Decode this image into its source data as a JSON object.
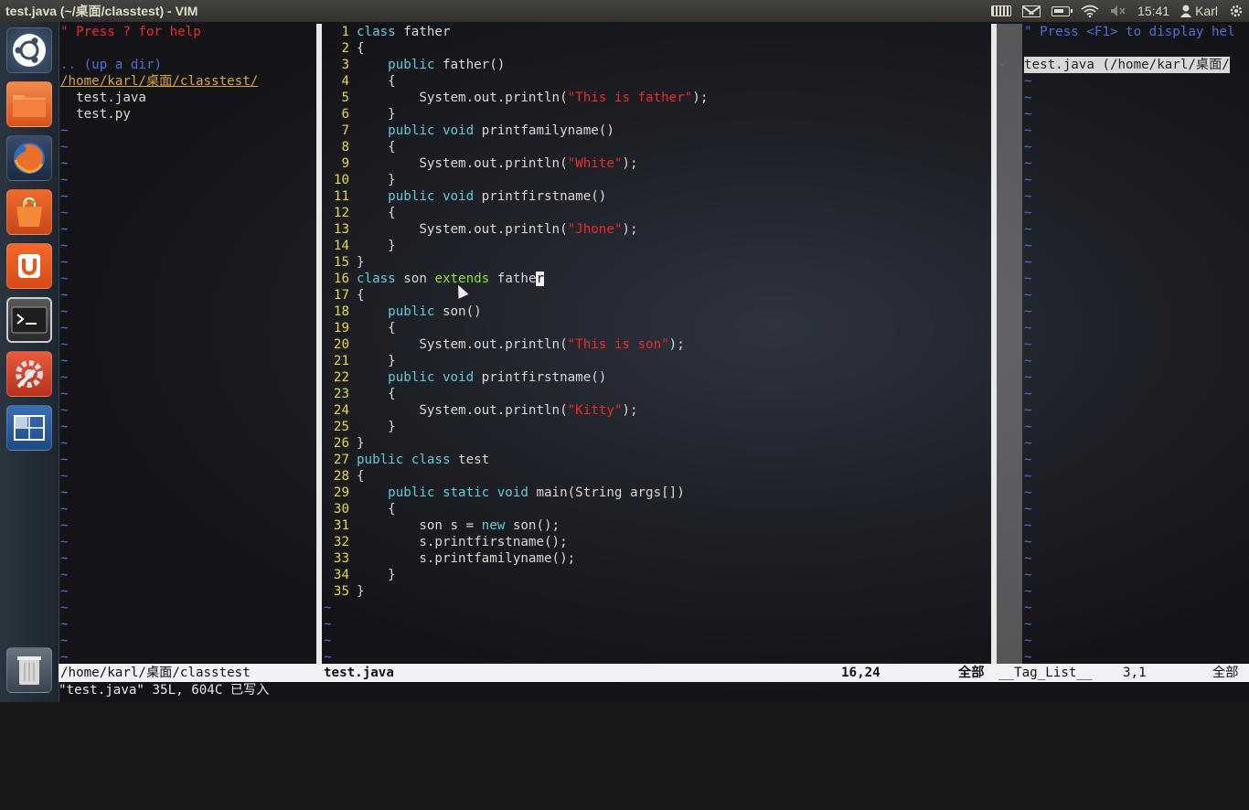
{
  "window": {
    "title": "test.java (~/桌面/classtest) - VIM"
  },
  "panel": {
    "clock": "15:41",
    "user": "Karl"
  },
  "launcher": {
    "items": [
      {
        "name": "dash-home",
        "color": "#3b4c63"
      },
      {
        "name": "files",
        "color": "#e86a2c"
      },
      {
        "name": "firefox",
        "color": "#d36a1c"
      },
      {
        "name": "software-center",
        "color": "#e25a1c"
      },
      {
        "name": "ubuntu-one",
        "color": "#e8561a"
      },
      {
        "name": "terminal",
        "color": "#2b2b2b"
      },
      {
        "name": "system-settings",
        "color": "#c83b2a"
      },
      {
        "name": "workspaces",
        "color": "#2f5f9e"
      },
      {
        "name": "trash",
        "color": "#5a6572"
      }
    ]
  },
  "nerdtree": {
    "help": "\" Press ? for help",
    "up_dir": ".. (up a dir)",
    "cwd": "/home/karl/桌面/classtest/",
    "files": [
      "  test.java",
      "  test.py"
    ],
    "tilde": "~"
  },
  "code": {
    "lines": [
      "class father",
      "{",
      "    public father()",
      "    {",
      "        System.out.println(\"This is father\");",
      "    }",
      "    public void printfamilyname()",
      "    {",
      "        System.out.println(\"White\");",
      "    }",
      "    public void printfirstname()",
      "    {",
      "        System.out.println(\"Jhone\");",
      "    }",
      "}",
      "class son extends father",
      "{",
      "    public son()",
      "    {",
      "        System.out.println(\"This is son\");",
      "    }",
      "    public void printfirstname()",
      "    {",
      "        System.out.println(\"Kitty\");",
      "    }",
      "}",
      "public class test",
      "{",
      "    public static void main(String args[])",
      "    {",
      "        son s = new son();",
      "        s.printfirstname();",
      "        s.printfamilyname();",
      "    }",
      "}"
    ],
    "cursor": {
      "line": 16,
      "col": 24
    }
  },
  "taglist": {
    "help": "\" Press <F1> to display hel",
    "file": "test.java (/home/karl/桌面/",
    "fold": "-"
  },
  "status": {
    "left_path": "/home/karl/桌面/classtest",
    "file": "test.java",
    "position": "16,24",
    "all1": "全部",
    "taglist": "__Tag_List__",
    "taglist_pos": "3,1",
    "all2": "全部"
  },
  "cmdline": "\"test.java\" 35L, 604C 已写入"
}
